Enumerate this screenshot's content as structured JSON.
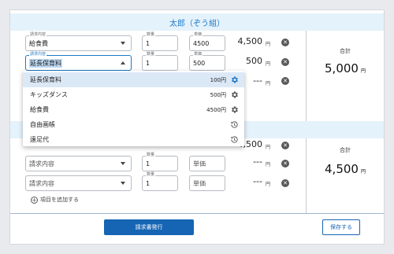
{
  "section1": {
    "title": "太郎（ぞう組）"
  },
  "labels": {
    "content": "請求内容",
    "qty": "数量",
    "price": "単価"
  },
  "rows": [
    {
      "content": "給食費",
      "qty": "1",
      "price": "4500",
      "amount": "4,500",
      "yen": "円"
    },
    {
      "content": "延長保育料",
      "qty": "1",
      "price": "500",
      "amount": "500",
      "yen": "円"
    },
    {
      "content": "",
      "qty": "",
      "price": "",
      "amount": "---",
      "yen": "円"
    }
  ],
  "rows2": [
    {
      "amount": "4,500",
      "yen": "円"
    },
    {
      "content_placeholder": "請求内容",
      "qty": "1",
      "price_placeholder": "単価",
      "amount": "---",
      "yen": "円"
    },
    {
      "content_placeholder": "請求内容",
      "qty": "1",
      "price_placeholder": "単価",
      "amount": "---",
      "yen": "円"
    }
  ],
  "total1": {
    "label": "合計",
    "value": "5,000",
    "unit": "円"
  },
  "total2": {
    "label": "合計",
    "value": "4,500",
    "unit": "円"
  },
  "add_item": "項目を追加する",
  "issue_button": "請求書発行",
  "save_button": "保存する",
  "dropdown": {
    "options": [
      {
        "name": "延長保育料",
        "price": "100円",
        "icon": "gear-icon"
      },
      {
        "name": "キッズダンス",
        "price": "500円",
        "icon": "gear-icon"
      },
      {
        "name": "給食費",
        "price": "4500円",
        "icon": "gear-icon"
      },
      {
        "name": "自由画帳",
        "price": "",
        "icon": "history-icon"
      },
      {
        "name": "遠足代",
        "price": "",
        "icon": "history-icon"
      }
    ]
  },
  "colors": {
    "accent": "#1e78c8",
    "button": "#1565b4",
    "header_bg": "#e4f2fb"
  }
}
